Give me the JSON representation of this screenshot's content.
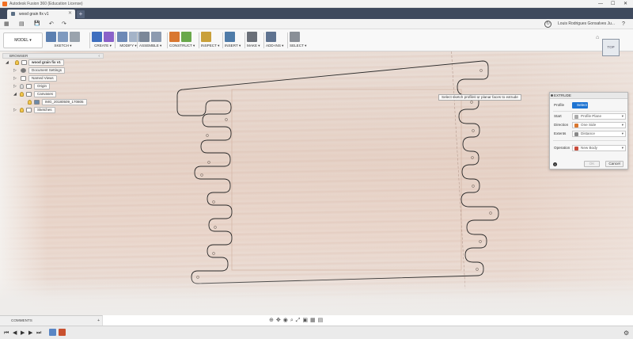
{
  "window": {
    "title": "Autodesk Fusion 360 (Education License)",
    "minimize": "—",
    "maximize": "☐",
    "close": "✕"
  },
  "tabs": {
    "doc_label": "wood grain fix v1",
    "close": "✕",
    "new": "+"
  },
  "quick_access": {
    "grid": "▦",
    "file": "▤",
    "save": "💾",
    "undo": "↶",
    "redo": "↷",
    "account": "Louis Rodrigues Gonsalves Ju...",
    "help": "?",
    "refresh": "↻"
  },
  "toolbar": {
    "workspace": "MODEL ▾",
    "groups": [
      {
        "name": "SKETCH ▾",
        "colors": [
          "#5b7fb0",
          "#7f9abf",
          "#9aa3ad"
        ]
      },
      {
        "name": "CREATE ▾",
        "colors": [
          "#3f6fbf",
          "#8a62c9"
        ]
      },
      {
        "name": "MODIFY ▾",
        "colors": [
          "#6d89b6",
          "#a4b3c8"
        ]
      },
      {
        "name": "ASSEMBLE ▾",
        "colors": [
          "#7b8798",
          "#8d9bb0"
        ]
      },
      {
        "name": "CONSTRUCT ▾",
        "colors": [
          "#d9772f",
          "#69a84b"
        ]
      },
      {
        "name": "INSPECT ▾",
        "colors": [
          "#c9a03a"
        ]
      },
      {
        "name": "INSERT ▾",
        "colors": [
          "#4f7ba8"
        ]
      },
      {
        "name": "MAKE ▾",
        "colors": [
          "#6a6f78"
        ]
      },
      {
        "name": "ADD-INS ▾",
        "colors": [
          "#5f7390"
        ]
      },
      {
        "name": "SELECT ▾",
        "colors": [
          "#8a8f97"
        ]
      }
    ]
  },
  "browser": {
    "title": "BROWSER",
    "collapse": "‹",
    "items": {
      "root": "wood grain fix v1",
      "settings": "Document Settings",
      "views": "Named Views",
      "origin": "Origin",
      "canvases": "Canvases",
      "canvas_img": "IMG_20180509_170805",
      "sketches": "Sketches"
    }
  },
  "viewcube": {
    "face": "TOP",
    "home": "⌂"
  },
  "tooltip": "Select sketch profiles or planar faces to extrude",
  "extrude": {
    "title": "EXTRUDE",
    "profile_label": "Profile",
    "profile_value": "Select",
    "start_label": "Start",
    "start_value": "Profile Plane",
    "direction_label": "Direction",
    "direction_value": "One Side",
    "extent_label": "Extents",
    "extent_value": "Distance",
    "operation_label": "Operation",
    "operation_value": "New Body",
    "ok": "OK",
    "cancel": "Cancel",
    "info": "i",
    "dropdown": "▾"
  },
  "comments": {
    "label": "COMMENTS",
    "toggle": "+"
  },
  "navbar": {
    "orbit": "⊕",
    "pan": "✥",
    "look": "◉",
    "zoom": "⌕",
    "fit": "⤢",
    "display": "▣",
    "grid": "▦",
    "viewports": "▤"
  },
  "timeline": {
    "first": "⏮",
    "prev": "◀",
    "play": "▶",
    "next": "▶",
    "last": "⏭",
    "settings": "⚙"
  }
}
